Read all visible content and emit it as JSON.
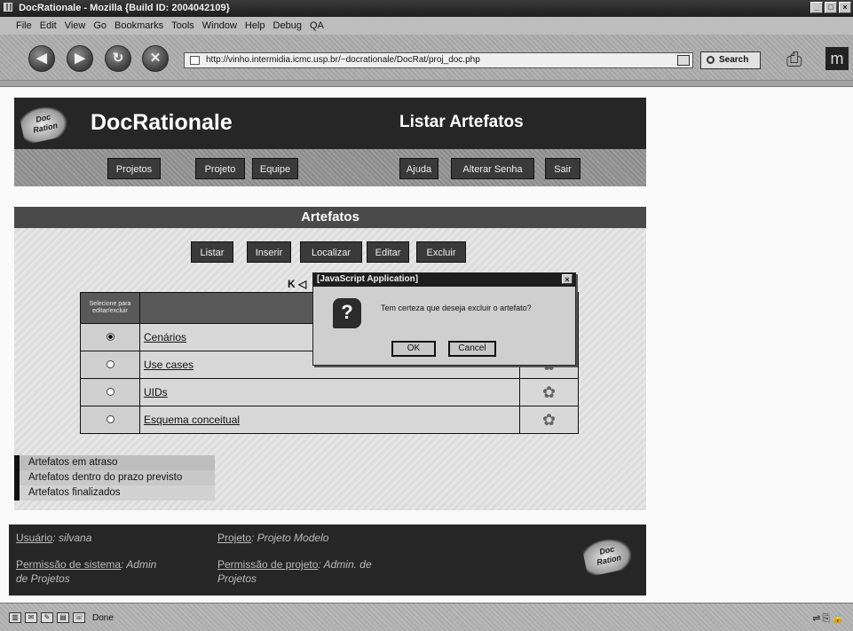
{
  "window": {
    "title": "DocRationale - Mozilla {Build ID: 2004042109}",
    "controls": [
      "_",
      "□",
      "×"
    ]
  },
  "menu": [
    "File",
    "Edit",
    "View",
    "Go",
    "Bookmarks",
    "Tools",
    "Window",
    "Help",
    "Debug",
    "QA"
  ],
  "toolbar": {
    "back_icon": "back-arrow-icon",
    "forward_icon": "forward-arrow-icon",
    "reload_icon": "reload-icon",
    "stop_icon": "stop-icon",
    "url": "http://vinho.intermidia.icmc.usp.br/~docrationale/DocRat/proj_doc.php",
    "search_label": "Search"
  },
  "app": {
    "logo_text": "Doc Ration",
    "name": "DocRationale",
    "page_title": "Listar Artefatos",
    "nav": [
      "Projetos",
      "Projeto",
      "Equipe",
      "Ajuda",
      "Alterar Senha",
      "Sair"
    ]
  },
  "section": {
    "title": "Artefatos",
    "actions": [
      "Listar",
      "Inserir",
      "Localizar",
      "Editar",
      "Excluir"
    ],
    "pager": "K ◁",
    "table_header": "Selecione para editar/excluir",
    "rows": [
      {
        "name": "Cenários",
        "selected": true
      },
      {
        "name": "Use cases",
        "selected": false
      },
      {
        "name": "UIDs",
        "selected": false
      },
      {
        "name": "Esquema conceitual",
        "selected": false
      }
    ]
  },
  "legend": [
    "Artefatos em atraso",
    "Artefatos dentro do prazo previsto",
    "Artefatos finalizados"
  ],
  "footer": {
    "user_label": "Usuário",
    "user_value": ": silvana",
    "project_label": "Projeto",
    "project_value": ": Projeto Modelo",
    "sys_perm_label": "Permissão de sistema",
    "sys_perm_value_1": ": Admin",
    "sys_perm_value_2": "de Projetos",
    "proj_perm_label": "Permissão de projeto",
    "proj_perm_value_1": ": Admin. de",
    "proj_perm_value_2": "Projetos"
  },
  "dialog": {
    "title": "[JavaScript Application]",
    "message": "Tem certeza que deseja excluir o artefato?",
    "ok": "OK",
    "cancel": "Cancel",
    "close": "×",
    "icon": "?"
  },
  "status": {
    "text": "Done"
  }
}
